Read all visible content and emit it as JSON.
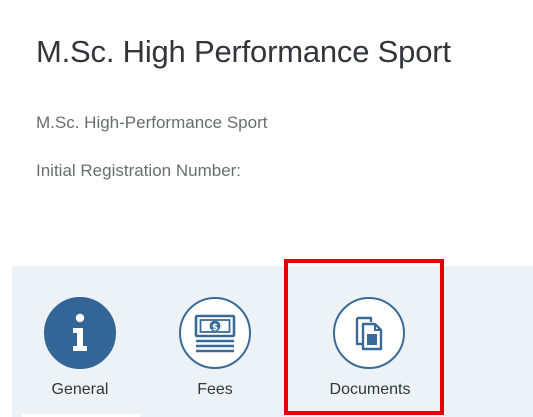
{
  "header": {
    "title": "M.Sc. High Performance Sport",
    "subtitle": "M.Sc. High-Performance Sport",
    "registration_label": "Initial Registration Number:"
  },
  "tabs": [
    {
      "label": "General",
      "icon": "info-icon",
      "selected": true
    },
    {
      "label": "Fees",
      "icon": "money-icon",
      "selected": false
    },
    {
      "label": "Documents",
      "icon": "documents-icon",
      "selected": false
    }
  ],
  "colors": {
    "accent": "#336697",
    "tabbar_background": "#edf2f7",
    "highlight": "#e60000",
    "title_text": "#32363a",
    "secondary_text": "#6a6d70"
  }
}
